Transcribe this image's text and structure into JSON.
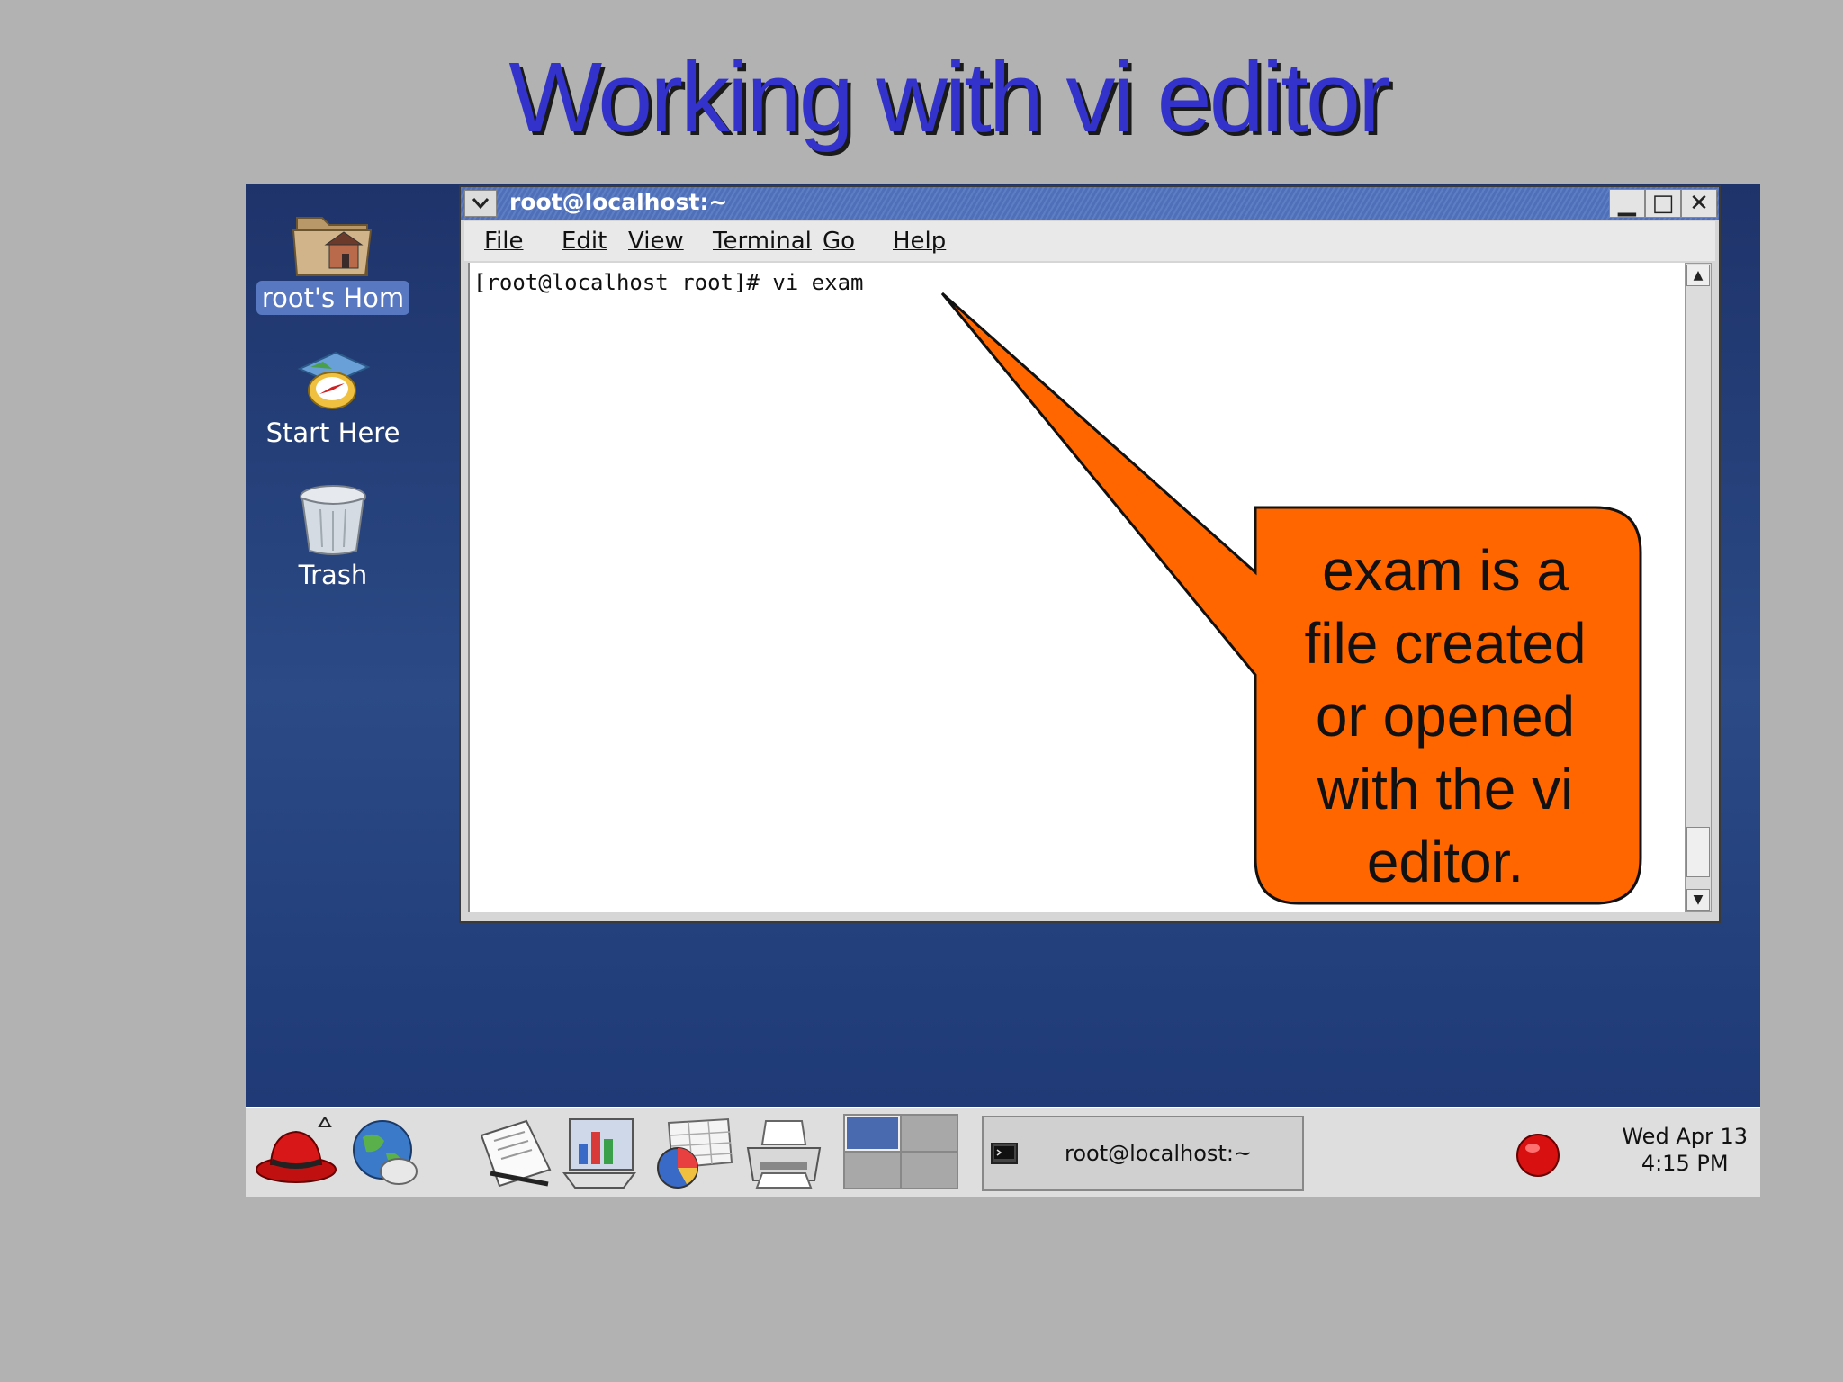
{
  "slide": {
    "title": "Working with vi editor"
  },
  "desktop": {
    "icons": [
      {
        "label": "root's Hom"
      },
      {
        "label": "Start Here"
      },
      {
        "label": "Trash"
      }
    ]
  },
  "window": {
    "title": "root@localhost:~",
    "controls": {
      "minimize": "▁",
      "maximize": "□",
      "close": "✕"
    },
    "menu": [
      "File",
      "Edit",
      "View",
      "Terminal",
      "Go",
      "Help"
    ],
    "terminal_line": "[root@localhost root]# vi exam"
  },
  "callout": {
    "lines": [
      "exam is a",
      "file created",
      "or opened",
      "with the vi",
      "editor."
    ],
    "color": "#ff6600"
  },
  "taskbar": {
    "task_title": "root@localhost:~",
    "clock": {
      "date": "Wed Apr 13",
      "time": "4:15 PM"
    }
  },
  "colors": {
    "title": "#3333cc",
    "desktop": "#24407c",
    "callout": "#ff6600"
  }
}
